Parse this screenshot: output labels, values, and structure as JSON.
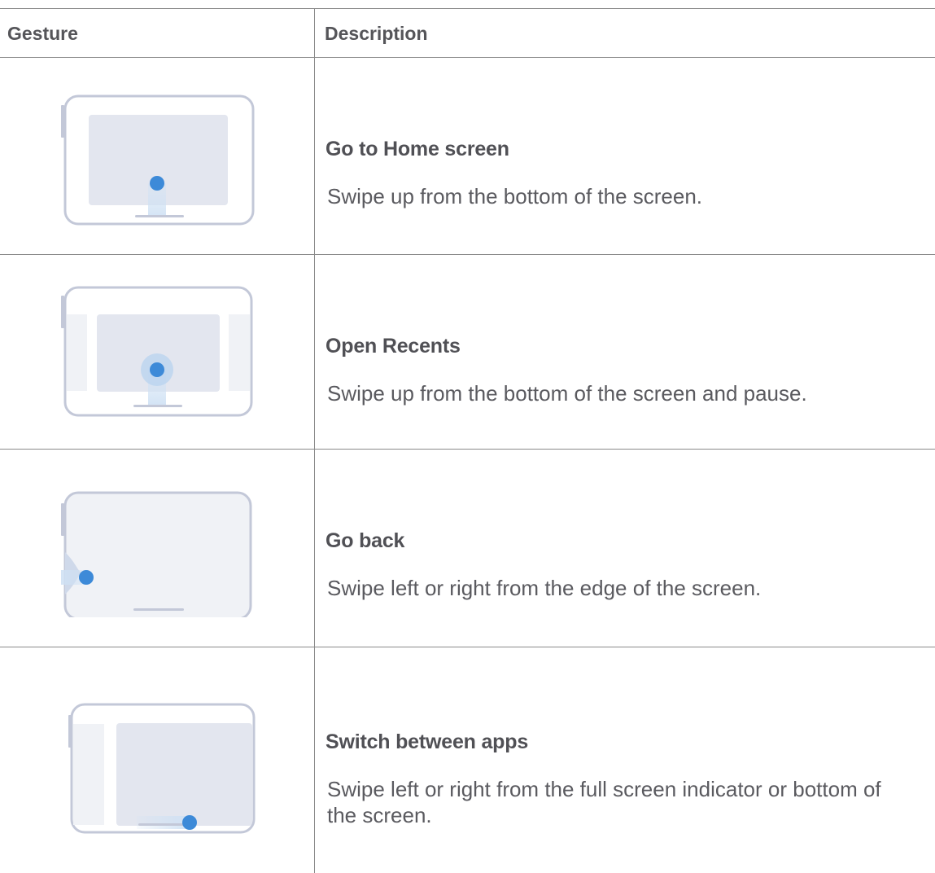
{
  "table": {
    "headers": {
      "gesture": "Gesture",
      "description": "Description"
    },
    "rows": [
      {
        "icon": "swipe-up-home-icon",
        "title": "Go to Home screen",
        "description": "Swipe up from the bottom of the screen."
      },
      {
        "icon": "swipe-up-pause-recents-icon",
        "title": "Open Recents",
        "description": "Swipe up from the bottom of the screen and pause."
      },
      {
        "icon": "swipe-edge-back-icon",
        "title": "Go back",
        "description": "Swipe left or right from the edge of the screen."
      },
      {
        "icon": "swipe-switch-apps-icon",
        "title": "Switch between apps",
        "description": "Swipe left or right from the full screen indicator or bottom of the screen."
      }
    ]
  },
  "colors": {
    "tablet_outline": "#c3c8d8",
    "screen_fill": "#e3e6ef",
    "touch_dot": "#3d8ad8",
    "border": "#8a8a8a"
  }
}
